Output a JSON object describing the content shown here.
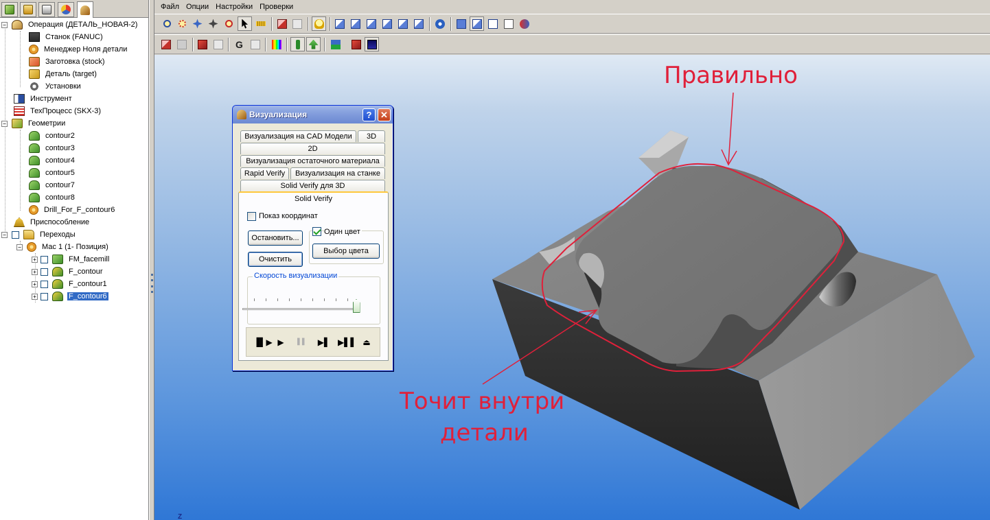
{
  "colors": {
    "annotation": "#e0203a",
    "selection": "#316ac5",
    "dialog_title": "#7c97d9"
  },
  "left_tabs": [
    {
      "icon": "cube-icon",
      "color": "#5aaa2a"
    },
    {
      "icon": "folder-icon",
      "color": "#d6a52a"
    },
    {
      "icon": "clipboard-icon",
      "color": "#7a7a7a"
    },
    {
      "icon": "palette-icon",
      "color": "#d9302a"
    },
    {
      "icon": "machine-icon",
      "color": "#9a5a10"
    }
  ],
  "tree": {
    "items": [
      {
        "label": "Операция (ДЕТАЛЬ_НОВАЯ-2)",
        "icon": "operation-icon"
      },
      {
        "label": "Станок (FANUC)",
        "icon": "machine-icon"
      },
      {
        "label": "Менеджер Ноля детали",
        "icon": "zero-manager-icon"
      },
      {
        "label": "Заготовка (stock)",
        "icon": "stock-icon"
      },
      {
        "label": "Деталь (target)",
        "icon": "target-icon"
      },
      {
        "label": "Установки",
        "icon": "settings-icon"
      },
      {
        "label": "Инструмент",
        "icon": "tool-icon"
      },
      {
        "label": "ТехПроцесс (SKX-3)",
        "icon": "process-icon"
      },
      {
        "label": "Геометрии",
        "icon": "geometry-icon"
      },
      {
        "label": "contour2",
        "icon": "contour-icon"
      },
      {
        "label": "contour3",
        "icon": "contour-icon"
      },
      {
        "label": "contour4",
        "icon": "contour-icon"
      },
      {
        "label": "contour5",
        "icon": "contour-icon"
      },
      {
        "label": "contour7",
        "icon": "contour-icon"
      },
      {
        "label": "contour8",
        "icon": "contour-icon"
      },
      {
        "label": "Drill_For_F_contour6",
        "icon": "drill-icon"
      },
      {
        "label": "Приспособление",
        "icon": "fixture-icon"
      },
      {
        "label": "Переходы",
        "icon": "folder-icon"
      },
      {
        "label": "Мас 1 (1- Позиция)",
        "icon": "setup-icon"
      },
      {
        "label": "FM_facemill",
        "icon": "facemill-icon"
      },
      {
        "label": "F_contour",
        "icon": "contour-op-icon"
      },
      {
        "label": "F_contour1",
        "icon": "contour-op-icon"
      },
      {
        "label": "F_contour6",
        "icon": "contour-op-icon",
        "selected": true
      }
    ]
  },
  "menu": [
    "Файл",
    "Опции",
    "Настройки",
    "Проверки"
  ],
  "toolbar1": [
    "zoom-icon",
    "zoom-box-icon",
    "pan-icon",
    "rotate-icon",
    "zoom-dynamic-icon",
    "select-cursor-icon",
    "ruler-icon",
    "cube-shaded-icon",
    "cube-wire-icon",
    "bulb-icon",
    "view-front-icon",
    "view-back-icon",
    "view-left-icon",
    "view-right-icon",
    "view-top-icon",
    "view-iso-icon",
    "view-solid-icon",
    "view-hidden-icon",
    "view-wire-icon",
    "view-outline-icon",
    "swap-icon"
  ],
  "toolbar2": [
    "stock-view-icon",
    "stock-edit-icon",
    "red-arrow-icon",
    "gray-arrow-icon",
    "g-code-icon",
    "gray-tool-icon",
    "color-bar-icon",
    "green-tool-icon",
    "green-arrow-icon",
    "stack-icon",
    "red-doc-icon",
    "monitor-icon"
  ],
  "annotations": {
    "correct": "Правильно",
    "inside_1": "Точит внутри",
    "inside_2": "детали"
  },
  "axis_label": "Z",
  "dialog": {
    "title": "Визуализация",
    "help": "?",
    "close": "✕",
    "tabs": [
      "Визуализация на  CAD Модели",
      "3D",
      "2D",
      "Визуализация остаточного материала",
      "Rapid Verify",
      "Визуализация на станке",
      "Solid Verify для 3D",
      "Solid Verify"
    ],
    "show_coords_label": "Показ координат",
    "show_coords_checked": false,
    "one_color_label": "Один цвет",
    "one_color_checked": true,
    "stop_button": "Остановить...",
    "clear_button": "Очистить",
    "color_button": "Выбор цвета",
    "speed_label": "Скорость визуализации",
    "speed_value": 1.0,
    "player": [
      "▐▌▶",
      "▶",
      "▌▌",
      "▶▌",
      "▶▌▌",
      "⏏"
    ]
  }
}
